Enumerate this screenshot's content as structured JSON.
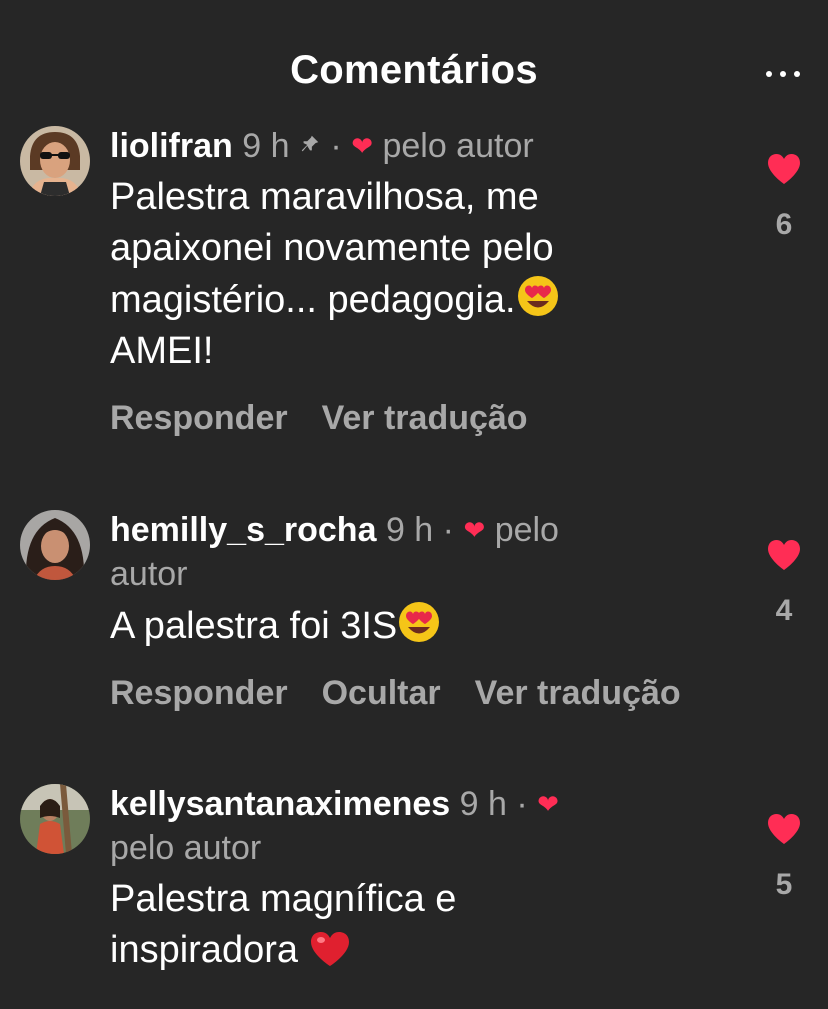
{
  "header": {
    "title": "Comentários",
    "more_icon": "more-horizontal-icon"
  },
  "colors": {
    "background": "#262626",
    "secondary_text": "#a8a8a8",
    "heart": "#ff2d55"
  },
  "comments": [
    {
      "username": "liolifran",
      "time": "9 h",
      "pinned": true,
      "separator": "·",
      "liked_by_author": "pelo autor",
      "text_lines": [
        "Palestra maravilhosa, me",
        "apaixonei novamente pelo",
        "magistério... pedagogia."
      ],
      "text_trailing_emoji": "smiling-face-with-heart-eyes",
      "text_last_line": "AMEI!",
      "likes": "6",
      "actions": [
        "Responder",
        "Ver tradução"
      ]
    },
    {
      "username": "hemilly_s_rocha",
      "time": "9 h",
      "separator": "·",
      "liked_by_author_part1": "pelo",
      "liked_by_author_part2": "autor",
      "text": "A palestra foi 3IS",
      "text_trailing_emoji": "smiling-face-with-heart-eyes",
      "likes": "4",
      "actions": [
        "Responder",
        "Ocultar",
        "Ver tradução"
      ]
    },
    {
      "username": "kellysantanaximenes",
      "time": "9 h",
      "separator": "·",
      "liked_by_author": "pelo autor",
      "text_lines": [
        "Palestra magnífica e",
        "inspiradora"
      ],
      "text_trailing_emoji": "red-heart",
      "likes": "5"
    }
  ]
}
